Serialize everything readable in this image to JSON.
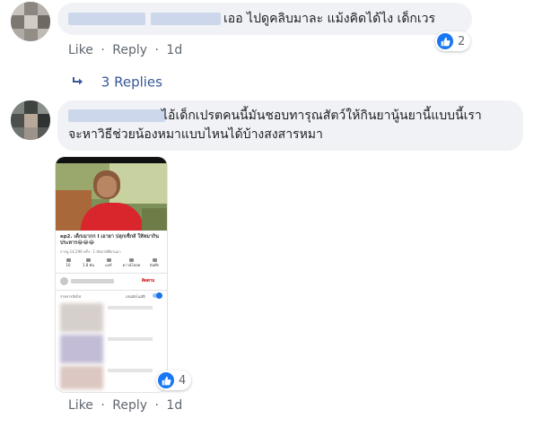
{
  "comment1": {
    "text": "เออ ไปดูคลิบมาละ แม้งคิดได้ไง เด็กเวร",
    "actions": {
      "like": "Like",
      "reply": "Reply",
      "time": "1d",
      "sep": "·"
    },
    "reaction_count": "2",
    "replies_label": "3 Replies"
  },
  "comment2": {
    "line1": "ไอ้เด็กเปรตคนนี้มันชอบทารุณสัตว์ให้กินยานู้นยานี้แบบนี้เรา",
    "line2": "จะหาวิธีช่วยน้องหมาแบบไหนได้บ้างสงสารหมา",
    "actions": {
      "like": "Like",
      "reply": "Reply",
      "time": "1d",
      "sep": "·"
    },
    "reaction_count": "4"
  },
  "screenshot": {
    "video_title": "ep2. เด็กเมากก I เอายา ปลุกเซ็กส์ ให้หมากิน ประหาร😂😂😂",
    "views": "การดู 14,296 ครั้ง · 1 สัปดาห์ที่ผ่านมา",
    "stat_labels": [
      "10",
      "1.8 พัน",
      "แชร์",
      "ดาวน์โหลด",
      "บันทึก"
    ],
    "subscribe": "ติดตาม",
    "up_next": "รายการถัดไป",
    "autoplay": "เล่นอัตโนมัติ"
  },
  "colors": {
    "link": "#385898",
    "meta": "#606770",
    "like_blue": "#1877f2",
    "bubble": "#f0f2f5",
    "subscribe_red": "#cc0000"
  }
}
